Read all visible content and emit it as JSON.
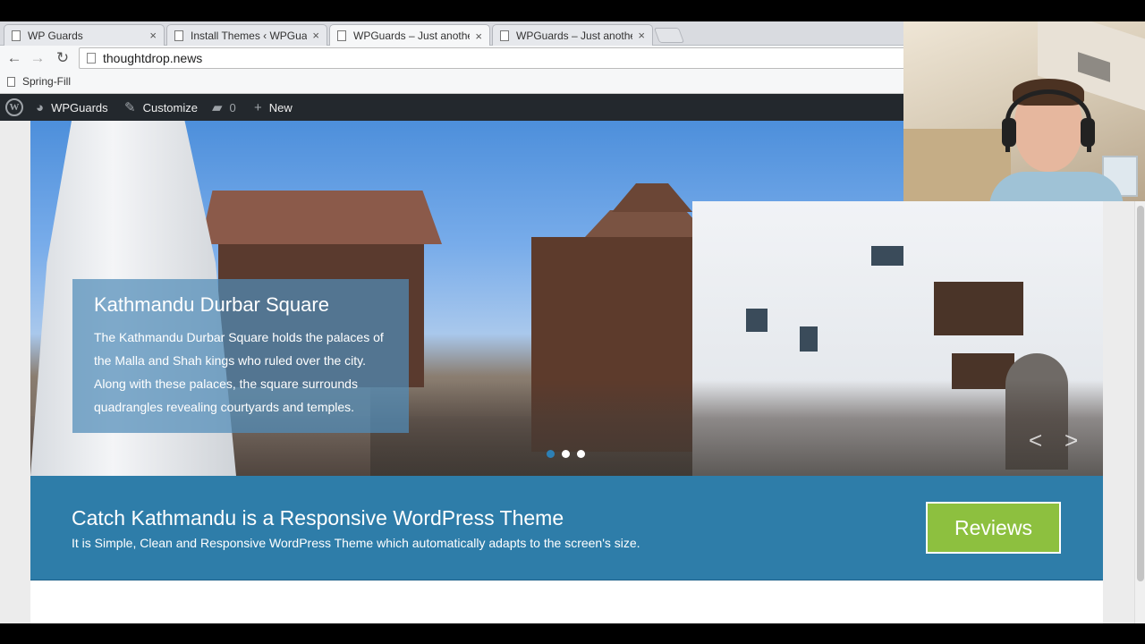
{
  "browser": {
    "tabs": [
      {
        "label": "WP Guards",
        "active": false
      },
      {
        "label": "Install Themes ‹ WPGuards",
        "active": false
      },
      {
        "label": "WPGuards – Just another",
        "active": true
      },
      {
        "label": "WPGuards – Just another",
        "active": false
      }
    ],
    "tab_close_glyph": "×",
    "address": "thoughtdrop.news",
    "bookmark": "Spring-Fill"
  },
  "admin_bar": {
    "logo_letter": "W",
    "site_name": "WPGuards",
    "customize": "Customize",
    "comments_count": "0",
    "new_label": "New"
  },
  "slider": {
    "title": "Kathmandu Durbar Square",
    "text": "The Kathmandu Durbar Square holds the palaces of the Malla and Shah kings who ruled over the city. Along with these palaces, the square surrounds quadrangles revealing courtyards and temples.",
    "slide_count": 3,
    "active_slide": 1,
    "prev_glyph": "<",
    "next_glyph": ">"
  },
  "promo": {
    "heading": "Catch Kathmandu is a Responsive WordPress Theme",
    "subtext": "It is Simple, Clean and Responsive WordPress Theme which automatically adapts to the screen's size.",
    "button_label": "Reviews"
  },
  "colors": {
    "admin_bar": "#23282d",
    "promo_bg": "#2e7da9",
    "button_green": "#8dc03f",
    "caption_bg": "#508cb9"
  },
  "icons": {
    "back": "back-arrow-icon",
    "forward": "forward-arrow-icon",
    "reload": "reload-icon",
    "comments": "comment-bubble-icon",
    "customize": "paintbrush-icon",
    "new": "plus-icon",
    "dashboard": "dashboard-gauge-icon"
  }
}
